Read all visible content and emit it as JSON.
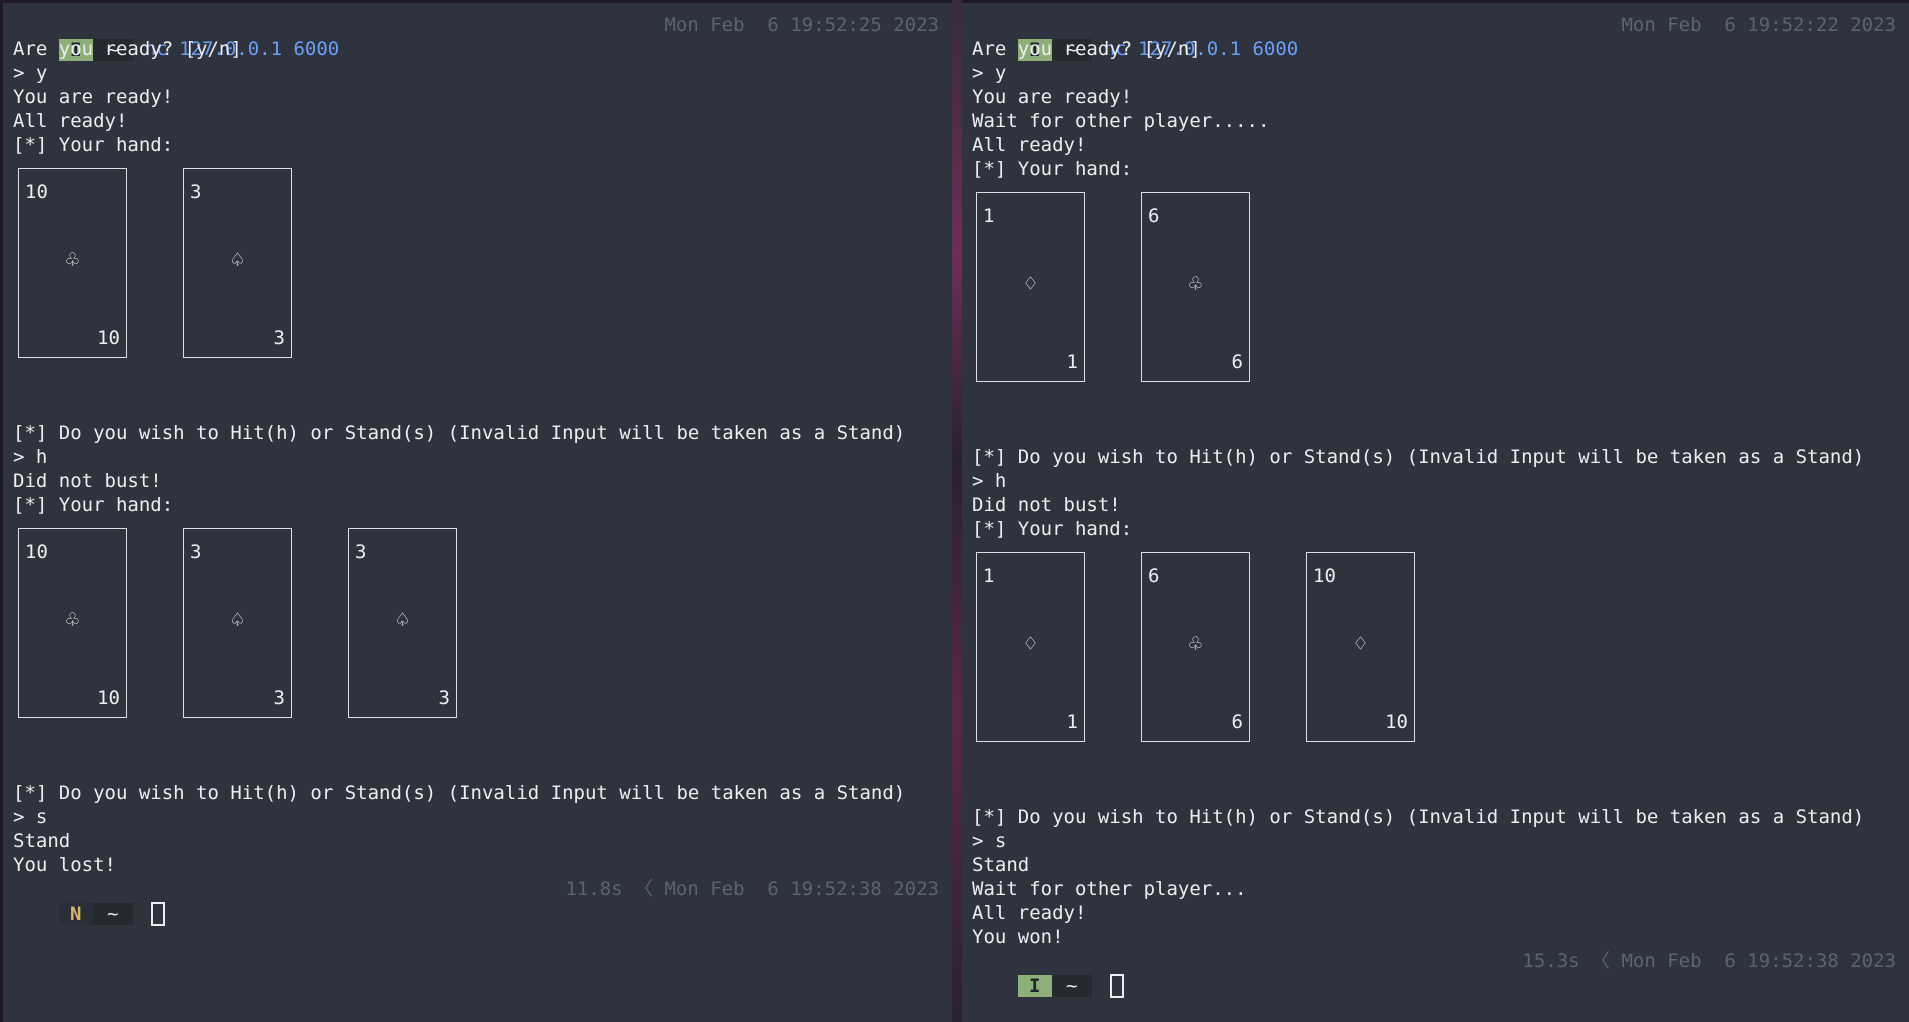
{
  "left_pane": {
    "prompt": {
      "mode": "I",
      "dir": "~",
      "command": "nc 127.0.0.1 6000",
      "time": "Mon Feb  6 19:52:25 2023"
    },
    "lines": {
      "l1": "Are you ready? [y/n]",
      "l2": "> y",
      "l3": "You are ready!",
      "l4": "All ready!",
      "l5": "[*] Your hand:",
      "l6": "[*] Do you wish to Hit(h) or Stand(s) (Invalid Input will be taken as a Stand)",
      "l7": "> h",
      "l8": "Did not bust!",
      "l9": "[*] Your hand:",
      "l10": "[*] Do you wish to Hit(h) or Stand(s) (Invalid Input will be taken as a Stand)",
      "l11": "> s",
      "l12": "Stand",
      "l13": "You lost!"
    },
    "hand1": [
      {
        "rank": "10",
        "suit": "♧"
      },
      {
        "rank": "3",
        "suit": "♤"
      }
    ],
    "hand2": [
      {
        "rank": "10",
        "suit": "♧"
      },
      {
        "rank": "3",
        "suit": "♤"
      },
      {
        "rank": "3",
        "suit": "♤"
      }
    ],
    "end_prompt": {
      "mode": "N",
      "dir": "~",
      "status": "11.8s 〈 Mon Feb  6 19:52:38 2023"
    }
  },
  "right_pane": {
    "prompt": {
      "mode": "I",
      "dir": "~",
      "command": "nc 127.0.0.1 6000",
      "time": "Mon Feb  6 19:52:22 2023"
    },
    "lines": {
      "l1": "Are you ready? [y/n]",
      "l2": "> y",
      "l3": "You are ready!",
      "l4": "Wait for other player.....",
      "l5": "All ready!",
      "l6": "[*] Your hand:",
      "l7": "[*] Do you wish to Hit(h) or Stand(s) (Invalid Input will be taken as a Stand)",
      "l8": "> h",
      "l9": "Did not bust!",
      "l10": "[*] Your hand:",
      "l11": "[*] Do you wish to Hit(h) or Stand(s) (Invalid Input will be taken as a Stand)",
      "l12": "> s",
      "l13": "Stand",
      "l14": "Wait for other player...",
      "l15": "All ready!",
      "l16": "You won!"
    },
    "hand1": [
      {
        "rank": "1",
        "suit": "♢"
      },
      {
        "rank": "6",
        "suit": "♧"
      }
    ],
    "hand2": [
      {
        "rank": "1",
        "suit": "♢"
      },
      {
        "rank": "6",
        "suit": "♧"
      },
      {
        "rank": "10",
        "suit": "♢"
      }
    ],
    "end_prompt": {
      "mode": "I",
      "dir": "~",
      "status": "15.3s 〈 Mon Feb  6 19:52:38 2023"
    }
  },
  "colors": {
    "background": "#2e333d",
    "text": "#ecedf0",
    "command": "#6c9ef8",
    "dim": "#5c6370",
    "insert_mode": "#8faf78",
    "normal_mode": "#d8b66a"
  }
}
